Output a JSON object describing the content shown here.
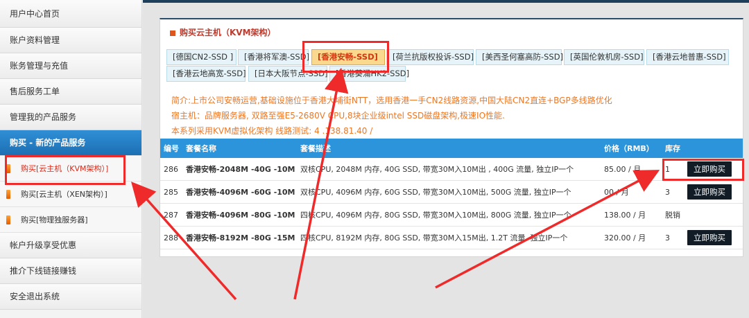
{
  "sidebar": {
    "items": [
      {
        "label": "用户中心首页"
      },
      {
        "label": "账户资料管理"
      },
      {
        "label": "账务管理与充值"
      },
      {
        "label": "售后服务工单"
      },
      {
        "label": "管理我的产品服务"
      },
      {
        "label": "购买 - 新的产品服务"
      }
    ],
    "subitems": [
      {
        "label": "购买[云主机（KVM架构）]"
      },
      {
        "label": "购买[云主机（XEN架构）]"
      },
      {
        "label": "购买[物理独服务器]"
      }
    ],
    "bottom_items": [
      {
        "label": "帐户升级享受优惠"
      },
      {
        "label": "推介下线链接赚钱"
      },
      {
        "label": "安全退出系统"
      }
    ]
  },
  "panel": {
    "title": "购买云主机（KVM架构）"
  },
  "tabs": [
    {
      "label": "[德国CN2-SSD ]"
    },
    {
      "label": "[香港将军澳-SSD]"
    },
    {
      "label": "[香港安畅-SSD]"
    },
    {
      "label": "[荷兰抗版权投诉-SSD]"
    },
    {
      "label": "[美西圣何塞高防-SSD]"
    },
    {
      "label": "[英国伦敦机房-SSD]"
    },
    {
      "label": "[香港云地普惠-SSD]"
    },
    {
      "label": "[香港云地高宽-SSD]"
    },
    {
      "label": "[日本大阪节点-SSD]"
    },
    {
      "label": "[香港葵涌HK2-SSD]"
    }
  ],
  "description": {
    "line1": "简介:上市公司安畅运营,基础设施位于香港大埔街NTT，选用香港一手CN2线路资源,中国大陆CN2直连+BGP多线路优化",
    "line2": "宿主机：品牌服务器, 双路至强E5-2680V CPU,8块企业级intel SSD磁盘架构,极速IO性能.",
    "line3": "本系列采用KVM虚拟化架构 线路测试: 4 .138.81.40 /"
  },
  "table": {
    "headers": {
      "id": "编号",
      "name": "套餐名称",
      "desc": "套餐描述",
      "price": "价格（RMB）",
      "stock": "库存"
    },
    "rows": [
      {
        "id": "286",
        "name": "香港安畅-2048M -40G -10M",
        "desc": "双核CPU, 2048M 内存, 40G SSD, 带宽30M入10M出 , 400G 流量, 独立IP一个",
        "price": "85.00 / 月",
        "stock": "1",
        "button": "立即购买"
      },
      {
        "id": "285",
        "name": "香港安畅-4096M -60G -10M",
        "desc": "双核CPU, 4096M 内存, 60G SSD, 带宽30M入10M出, 500G 流量, 独立IP一个",
        "price": "00 / 月",
        "stock": "3",
        "button": "立即购买"
      },
      {
        "id": "287",
        "name": "香港安畅-4096M -80G -10M",
        "desc": "四核CPU, 4096M 内存, 80G SSD, 带宽30M入10M出, 800G 流量, 独立IP一个",
        "price": "138.00 / 月",
        "stock": "脱销",
        "button": ""
      },
      {
        "id": "288",
        "name": "香港安畅-8192M -80G -15M",
        "desc": "四核CPU, 8192M 内存, 80G SSD, 带宽30M入15M出, 1.2T 流量, 独立IP一个",
        "price": "320.00 / 月",
        "stock": "3",
        "button": "立即购买"
      }
    ]
  },
  "colors": {
    "annotation": "#ef2a2a",
    "table_header": "#2b94db",
    "sidebar_active": "#2f8fd6",
    "description_text": "#ec7724"
  }
}
